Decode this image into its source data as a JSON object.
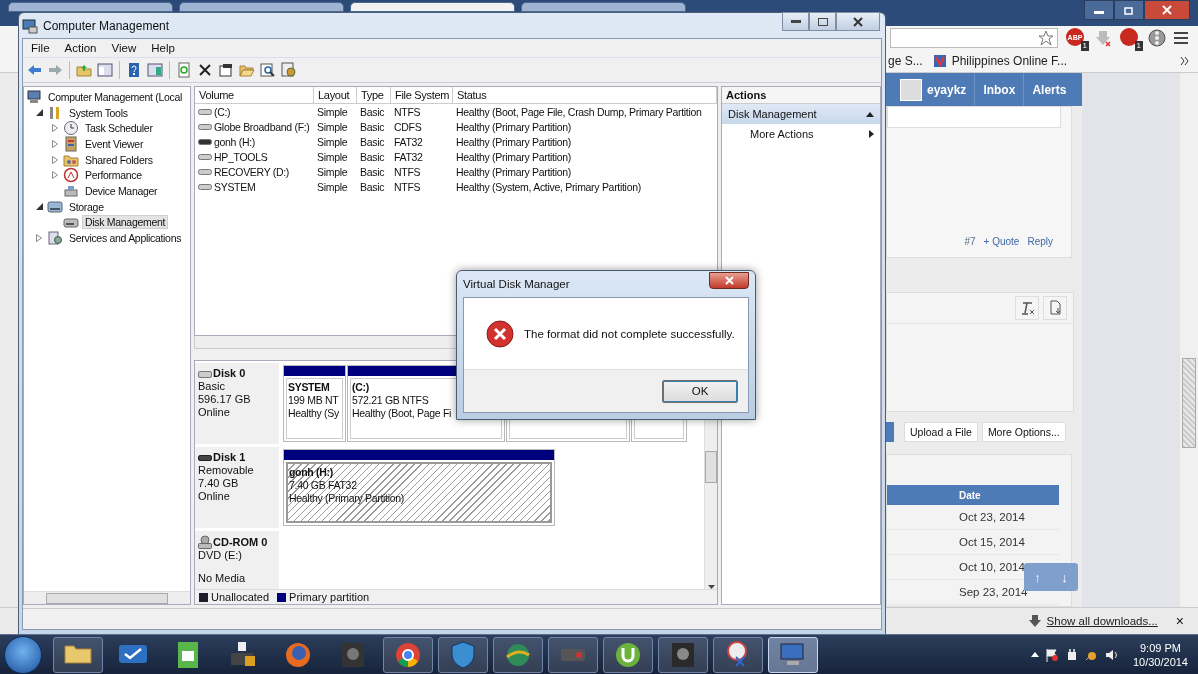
{
  "browser": {
    "tabs": [
      {
        "selected": false
      },
      {
        "selected": false
      },
      {
        "selected": true
      },
      {
        "selected": false
      }
    ],
    "adblock_label": "ABP",
    "extension_badges": [
      "1",
      "1"
    ],
    "bookmarks": [
      "ge S...",
      "Philippines Online F..."
    ],
    "forum": {
      "user": "eyaykz",
      "nav": [
        "Inbox",
        "Alerts"
      ],
      "post": {
        "number": "#7",
        "quote": "+ Quote",
        "reply": "Reply"
      },
      "buttons": [
        "Upload a File",
        "More Options..."
      ],
      "table": {
        "columns": [
          "Date"
        ],
        "rows": [
          "Oct 23, 2014",
          "Oct 15, 2014",
          "Oct 10, 2014",
          "Sep 23, 2014"
        ]
      },
      "scroll_buttons": [
        "↑",
        "↓"
      ]
    },
    "downloads": {
      "link": "Show all downloads...",
      "close": "×"
    }
  },
  "window": {
    "title": "Computer Management",
    "menu": [
      "File",
      "Action",
      "View",
      "Help"
    ],
    "tree": [
      {
        "label": "Computer Management (Local",
        "selected": false,
        "children": [
          {
            "label": "System Tools",
            "expanded": true,
            "selected": false,
            "children": [
              {
                "label": "Task Scheduler",
                "expanded": false,
                "selected": false
              },
              {
                "label": "Event Viewer",
                "expanded": false,
                "selected": false
              },
              {
                "label": "Shared Folders",
                "expanded": false,
                "selected": false
              },
              {
                "label": "Performance",
                "expanded": false,
                "selected": false
              },
              {
                "label": "Device Manager",
                "selected": false
              }
            ]
          },
          {
            "label": "Storage",
            "expanded": true,
            "selected": false,
            "children": [
              {
                "label": "Disk Management",
                "selected": true
              }
            ]
          },
          {
            "label": "Services and Applications",
            "expanded": false,
            "selected": false
          }
        ]
      }
    ],
    "volumes": {
      "columns": [
        "Volume",
        "Layout",
        "Type",
        "File System",
        "Status"
      ],
      "rows": [
        [
          "(C:)",
          "Simple",
          "Basic",
          "NTFS",
          "Healthy (Boot, Page File, Crash Dump, Primary Partition"
        ],
        [
          "Globe Broadband (F:)",
          "Simple",
          "Basic",
          "CDFS",
          "Healthy (Primary Partition)"
        ],
        [
          "gonh (H:)",
          "Simple",
          "Basic",
          "FAT32",
          "Healthy (Primary Partition)"
        ],
        [
          "HP_TOOLS",
          "Simple",
          "Basic",
          "FAT32",
          "Healthy (Primary Partition)"
        ],
        [
          "RECOVERY (D:)",
          "Simple",
          "Basic",
          "NTFS",
          "Healthy (Primary Partition)"
        ],
        [
          "SYSTEM",
          "Simple",
          "Basic",
          "NTFS",
          "Healthy (System, Active, Primary Partition)"
        ]
      ]
    },
    "disks": [
      {
        "kind": "basic",
        "name": "Disk 0",
        "info": [
          "Basic",
          "596.17 GB",
          "Online"
        ],
        "partitions": [
          {
            "name": "SYSTEM",
            "size": "199 MB NT",
            "status": "Healthy (Sy",
            "selected": false
          },
          {
            "name": "(C:)",
            "size": "572.21 GB NTFS",
            "status": "Healthy (Boot, Page Fi",
            "selected": false
          },
          {
            "selected": false
          },
          {
            "selected": false
          }
        ]
      },
      {
        "kind": "removable",
        "name": "Disk 1",
        "info": [
          "Removable",
          "7.40 GB",
          "Online"
        ],
        "partitions": [
          {
            "name": "gonh  (H:)",
            "size": "7.40 GB FAT32",
            "status": "Healthy (Primary Partition)",
            "selected": true
          }
        ]
      },
      {
        "kind": "cdrom",
        "name": "CD-ROM 0",
        "info": [
          "DVD (E:)",
          "No Media"
        ]
      }
    ],
    "legend": [
      {
        "label": "Unallocated",
        "color": "#1c1c2c"
      },
      {
        "label": "Primary partition",
        "color": "#00007f"
      }
    ],
    "actions": {
      "title": "Actions",
      "items": [
        {
          "kind": "section",
          "label": "Disk Management"
        },
        {
          "kind": "submenu",
          "label": "More Actions"
        }
      ]
    }
  },
  "dialog": {
    "title": "Virtual Disk Manager",
    "message": "The format did not complete successfully.",
    "buttons": [
      "OK"
    ]
  },
  "taskbar": {
    "apps": [
      {
        "running": true,
        "selected": false
      },
      {
        "running": false,
        "selected": false
      },
      {
        "running": false,
        "selected": false
      },
      {
        "running": false,
        "selected": false
      },
      {
        "running": false,
        "selected": false
      },
      {
        "running": false,
        "selected": false
      },
      {
        "running": true,
        "selected": false
      },
      {
        "running": true,
        "selected": false
      },
      {
        "running": true,
        "selected": false
      },
      {
        "running": true,
        "selected": false
      },
      {
        "running": true,
        "selected": false
      },
      {
        "running": true,
        "selected": false
      },
      {
        "running": true,
        "selected": false
      },
      {
        "running": true,
        "selected": true
      }
    ],
    "time": "9:09 PM",
    "date": "10/30/2014"
  }
}
